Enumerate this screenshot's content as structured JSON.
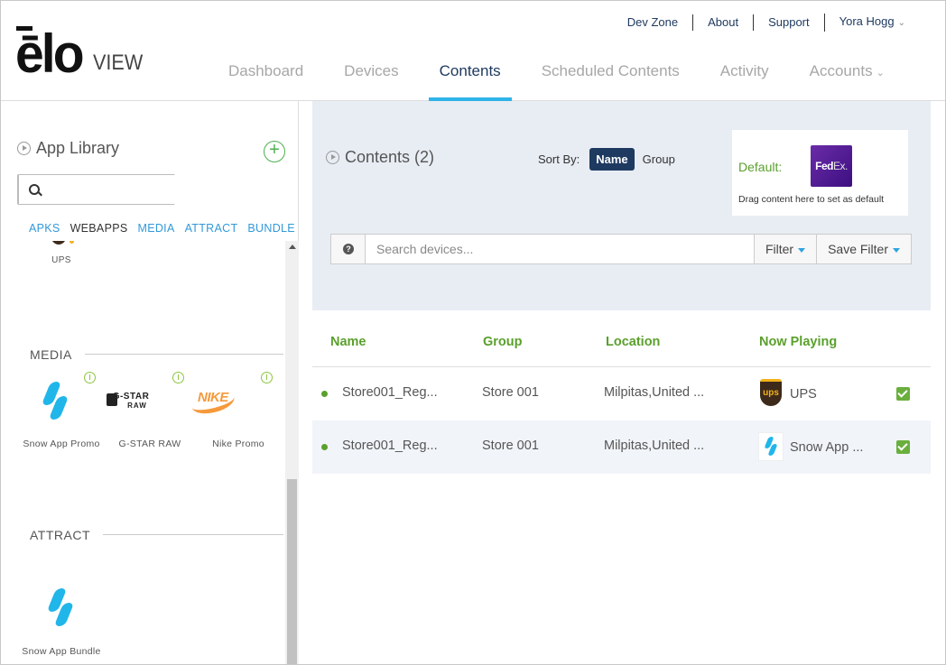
{
  "brand": {
    "logo_main": "ēlo",
    "logo_sub": "VIEW"
  },
  "toplinks": [
    "Dev Zone",
    "About",
    "Support",
    "Yora Hogg"
  ],
  "nav": {
    "tabs": [
      "Dashboard",
      "Devices",
      "Contents",
      "Scheduled Contents",
      "Activity",
      "Accounts"
    ],
    "active": "Contents"
  },
  "library": {
    "title": "App Library",
    "search_placeholder": "",
    "tabs": [
      "APKS",
      "WEBAPPS",
      "MEDIA",
      "ATTRACT",
      "BUNDLE"
    ],
    "active_tab": "WEBAPPS",
    "webapps_partial": {
      "name": "UPS"
    },
    "media_header": "MEDIA",
    "media_items": [
      {
        "name": "Snow App Promo",
        "logo": "snow-logo"
      },
      {
        "name": "G-STAR RAW",
        "logo": "gstar-logo",
        "logo_line1": "G-STAR",
        "logo_line2": "RAW"
      },
      {
        "name": "Nike Promo",
        "logo": "nike-logo",
        "logo_text": "NIKE"
      }
    ],
    "attract_header": "ATTRACT",
    "attract_items": [
      {
        "name": "Snow App Bundle",
        "logo": "snow-logo"
      }
    ]
  },
  "contents": {
    "title": "Contents (2)",
    "sort_label": "Sort By:",
    "sort_options": [
      "Name",
      "Group"
    ],
    "sort_active": "Name",
    "default": {
      "label": "Default:",
      "logo_fed": "Fed",
      "logo_ex": "Ex.",
      "hint": "Drag content here to set as default"
    },
    "search_placeholder": "Search devices...",
    "filter_label": "Filter",
    "save_filter_label": "Save Filter",
    "help_glyph": "?"
  },
  "table": {
    "headers": [
      "Name",
      "Group",
      "Location",
      "Now Playing"
    ],
    "rows": [
      {
        "name": "Store001_Reg...",
        "group": "Store 001",
        "location": "Milpitas,United ...",
        "now_playing": "UPS",
        "icon": "ups-logo",
        "icon_text": "ups",
        "checked": true
      },
      {
        "name": "Store001_Reg...",
        "group": "Store 001",
        "location": "Milpitas,United ...",
        "now_playing": "Snow App ...",
        "icon": "snow-logo",
        "checked": true
      }
    ]
  },
  "colors": {
    "nav_active": "#1f3a60",
    "nav_underline": "#2fb3e8",
    "green": "#5aa02c",
    "link_blue": "#3399d9",
    "panel_bg": "#e8edf4"
  }
}
